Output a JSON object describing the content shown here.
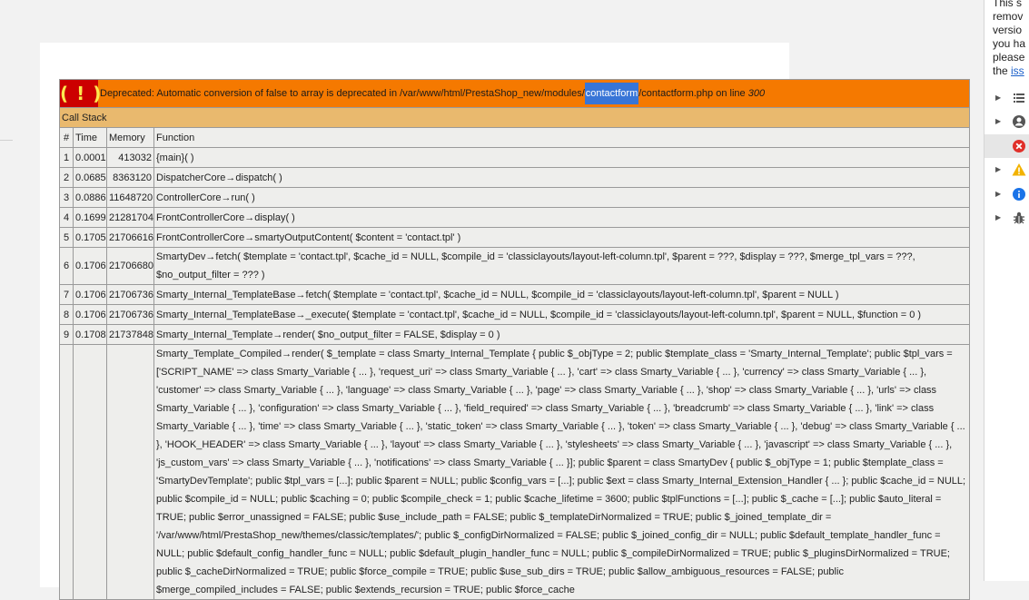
{
  "error": {
    "icon": "( ! )",
    "prefix": "Deprecated: Automatic conversion of false to array is deprecated in /var/www/html/PrestaShop_new/modules/",
    "highlight": "contactform",
    "suffix": "/contactform.php on line ",
    "line": "300"
  },
  "callstack": {
    "title": "Call Stack",
    "headers": [
      "#",
      "Time",
      "Memory",
      "Function"
    ],
    "rows": [
      {
        "n": "1",
        "time": "0.0001",
        "mem": "413032",
        "fn": "{main}( )"
      },
      {
        "n": "2",
        "time": "0.0685",
        "mem": "8363120",
        "fn": "DispatcherCore→dispatch( )"
      },
      {
        "n": "3",
        "time": "0.0886",
        "mem": "11648720",
        "fn": "ControllerCore→run( )"
      },
      {
        "n": "4",
        "time": "0.1699",
        "mem": "21281704",
        "fn": "FrontControllerCore→display( )"
      },
      {
        "n": "5",
        "time": "0.1705",
        "mem": "21706616",
        "fn": "FrontControllerCore→smartyOutputContent( $content = 'contact.tpl' )"
      },
      {
        "n": "6",
        "time": "0.1706",
        "mem": "21706680",
        "fn": "SmartyDev→fetch( $template = 'contact.tpl', $cache_id = NULL, $compile_id = 'classiclayouts/layout-left-column.tpl', $parent = ???, $display = ???, $merge_tpl_vars = ???, $no_output_filter = ??? )"
      },
      {
        "n": "7",
        "time": "0.1706",
        "mem": "21706736",
        "fn": "Smarty_Internal_TemplateBase→fetch( $template = 'contact.tpl', $cache_id = NULL, $compile_id = 'classiclayouts/layout-left-column.tpl', $parent = NULL )"
      },
      {
        "n": "8",
        "time": "0.1706",
        "mem": "21706736",
        "fn": "Smarty_Internal_TemplateBase→_execute( $template = 'contact.tpl', $cache_id = NULL, $compile_id = 'classiclayouts/layout-left-column.tpl', $parent = NULL, $function = 0 )"
      },
      {
        "n": "9",
        "time": "0.1708",
        "mem": "21737848",
        "fn": "Smarty_Internal_Template→render( $no_output_filter = FALSE, $display = 0 )"
      },
      {
        "n": "",
        "time": "",
        "mem": "",
        "fn": "Smarty_Template_Compiled→render( $_template = class Smarty_Internal_Template { public $_objType = 2; public $template_class = 'Smarty_Internal_Template'; public $tpl_vars = ['SCRIPT_NAME' => class Smarty_Variable { ... }, 'request_uri' => class Smarty_Variable { ... }, 'cart' => class Smarty_Variable { ... }, 'currency' => class Smarty_Variable { ... }, 'customer' => class Smarty_Variable { ... }, 'language' => class Smarty_Variable { ... }, 'page' => class Smarty_Variable { ... }, 'shop' => class Smarty_Variable { ... }, 'urls' => class Smarty_Variable { ... }, 'configuration' => class Smarty_Variable { ... }, 'field_required' => class Smarty_Variable { ... }, 'breadcrumb' => class Smarty_Variable { ... }, 'link' => class Smarty_Variable { ... }, 'time' => class Smarty_Variable { ... }, 'static_token' => class Smarty_Variable { ... }, 'token' => class Smarty_Variable { ... }, 'debug' => class Smarty_Variable { ... }, 'HOOK_HEADER' => class Smarty_Variable { ... }, 'layout' => class Smarty_Variable { ... }, 'stylesheets' => class Smarty_Variable { ... }, 'javascript' => class Smarty_Variable { ... }, 'js_custom_vars' => class Smarty_Variable { ... }, 'notifications' => class Smarty_Variable { ... }]; public $parent = class SmartyDev { public $_objType = 1; public $template_class = 'SmartyDevTemplate'; public $tpl_vars = [...]; public $parent = NULL; public $config_vars = [...]; public $ext = class Smarty_Internal_Extension_Handler { ... }; public $cache_id = NULL; public $compile_id = NULL; public $caching = 0; public $compile_check = 1; public $cache_lifetime = 3600; public $tplFunctions = [...]; public $_cache = [...]; public $auto_literal = TRUE; public $error_unassigned = FALSE; public $use_include_path = FALSE; public $_templateDirNormalized = TRUE; public $_joined_template_dir = '/var/www/html/PrestaShop_new/themes/classic/templates/'; public $_configDirNormalized = FALSE; public $_joined_config_dir = NULL; public $default_template_handler_func = NULL; public $default_config_handler_func = NULL; public $default_plugin_handler_func = NULL; public $_compileDirNormalized = TRUE; public $_pluginsDirNormalized = TRUE; public $_cacheDirNormalized = TRUE; public $force_compile = TRUE; public $use_sub_dirs = TRUE; public $allow_ambiguous_resources = FALSE; public $merge_compiled_includes = FALSE; public $extends_recursion = TRUE; public $force_cache"
      }
    ]
  },
  "devtools": {
    "message_lines": [
      "This s",
      "remov",
      "versio",
      "you ha",
      "please"
    ],
    "message_prefix": "the ",
    "message_link": "iss",
    "rows": [
      {
        "icon": "list-icon",
        "color": "#555555"
      },
      {
        "icon": "user-icon",
        "color": "#555555"
      },
      {
        "icon": "error-icon",
        "color": "#e0302a"
      },
      {
        "icon": "warning-icon",
        "color": "#f2b200"
      },
      {
        "icon": "info-icon",
        "color": "#1a73e8"
      },
      {
        "icon": "bug-icon",
        "color": "#555555"
      }
    ]
  }
}
